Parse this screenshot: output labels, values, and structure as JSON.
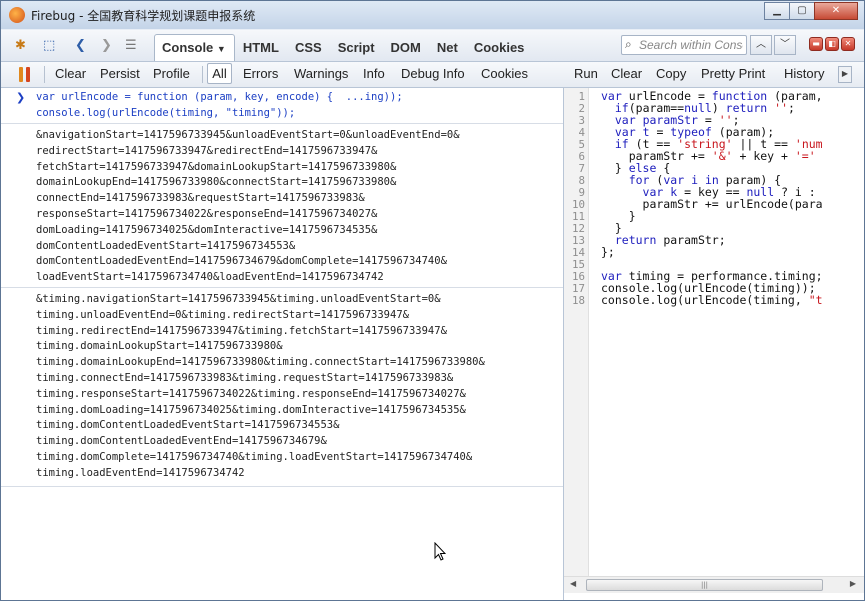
{
  "window": {
    "title": "Firebug - 全国教育科学规划课题申报系统"
  },
  "toolbar_main": {
    "tabs": [
      {
        "label": "Console",
        "active": true
      },
      {
        "label": "HTML"
      },
      {
        "label": "CSS"
      },
      {
        "label": "Script"
      },
      {
        "label": "DOM"
      },
      {
        "label": "Net"
      },
      {
        "label": "Cookies"
      }
    ],
    "search_placeholder": "Search within Console"
  },
  "toolbar_console": {
    "clear": "Clear",
    "persist": "Persist",
    "profile": "Profile",
    "all": "All",
    "errors": "Errors",
    "warnings": "Warnings",
    "info": "Info",
    "debug_info": "Debug Info",
    "cookies": "Cookies",
    "run": "Run",
    "clear_editor": "Clear",
    "copy": "Copy",
    "pretty_print": "Pretty Print",
    "history": "History"
  },
  "console": {
    "prompt": "❯",
    "command_lines": [
      "var urlEncode = function (param, key, encode) {  ...ing));",
      "console.log(urlEncode(timing, \"timing\"));"
    ],
    "output1": [
      "&navigationStart=1417596733945&unloadEventStart=0&unloadEventEnd=0&",
      "redirectStart=1417596733947&redirectEnd=1417596733947&",
      "fetchStart=1417596733947&domainLookupStart=1417596733980&",
      "domainLookupEnd=1417596733980&connectStart=1417596733980&",
      "connectEnd=1417596733983&requestStart=1417596733983&",
      "responseStart=1417596734022&responseEnd=1417596734027&",
      "domLoading=1417596734025&domInteractive=1417596734535&",
      "domContentLoadedEventStart=1417596734553&",
      "domContentLoadedEventEnd=1417596734679&domComplete=1417596734740&",
      "loadEventStart=1417596734740&loadEventEnd=1417596734742"
    ],
    "output2": [
      "&timing.navigationStart=1417596733945&timing.unloadEventStart=0&",
      "timing.unloadEventEnd=0&timing.redirectStart=1417596733947&",
      "timing.redirectEnd=1417596733947&timing.fetchStart=1417596733947&",
      "timing.domainLookupStart=1417596733980&",
      "timing.domainLookupEnd=1417596733980&timing.connectStart=1417596733980&",
      "timing.connectEnd=1417596733983&timing.requestStart=1417596733983&",
      "timing.responseStart=1417596734022&timing.responseEnd=1417596734027&",
      "timing.domLoading=1417596734025&timing.domInteractive=1417596734535&",
      "timing.domContentLoadedEventStart=1417596734553&",
      "timing.domContentLoadedEventEnd=1417596734679&",
      "timing.domComplete=1417596734740&timing.loadEventStart=1417596734740&",
      "timing.loadEventEnd=1417596734742"
    ]
  },
  "editor": {
    "line_numbers": [
      "1",
      "2",
      "3",
      "4",
      "5",
      "6",
      "7",
      "8",
      "9",
      "10",
      "11",
      "12",
      "13",
      "14",
      "15",
      "16",
      "17",
      "18"
    ],
    "code_lines": [
      [
        {
          "t": "var",
          "k": "kw"
        },
        {
          "t": " urlEncode = "
        },
        {
          "t": "function",
          "k": "kw"
        },
        {
          "t": " (param,"
        }
      ],
      [
        {
          "t": "  "
        },
        {
          "t": "if",
          "k": "kw"
        },
        {
          "t": "(param=="
        },
        {
          "t": "null",
          "k": "kw"
        },
        {
          "t": ") "
        },
        {
          "t": "return",
          "k": "kw"
        },
        {
          "t": " "
        },
        {
          "t": "''",
          "k": "str"
        },
        {
          "t": ";"
        }
      ],
      [
        {
          "t": "  "
        },
        {
          "t": "var",
          "k": "kw"
        },
        {
          "t": " "
        },
        {
          "t": "paramStr",
          "k": "kw"
        },
        {
          "t": " = "
        },
        {
          "t": "''",
          "k": "str"
        },
        {
          "t": ";"
        }
      ],
      [
        {
          "t": "  "
        },
        {
          "t": "var",
          "k": "kw"
        },
        {
          "t": " "
        },
        {
          "t": "t",
          "k": "kw"
        },
        {
          "t": " = "
        },
        {
          "t": "typeof",
          "k": "kw"
        },
        {
          "t": " (param);"
        }
      ],
      [
        {
          "t": "  "
        },
        {
          "t": "if",
          "k": "kw"
        },
        {
          "t": " (t == "
        },
        {
          "t": "'string'",
          "k": "str"
        },
        {
          "t": " || t == "
        },
        {
          "t": "'num",
          "k": "str"
        }
      ],
      [
        {
          "t": "    paramStr += "
        },
        {
          "t": "'&'",
          "k": "str"
        },
        {
          "t": " + key + "
        },
        {
          "t": "'='",
          "k": "str"
        }
      ],
      [
        {
          "t": "  } "
        },
        {
          "t": "else",
          "k": "kw"
        },
        {
          "t": " {"
        }
      ],
      [
        {
          "t": "    "
        },
        {
          "t": "for",
          "k": "kw"
        },
        {
          "t": " ("
        },
        {
          "t": "var",
          "k": "kw"
        },
        {
          "t": " "
        },
        {
          "t": "i",
          "k": "kw"
        },
        {
          "t": " "
        },
        {
          "t": "in",
          "k": "kw"
        },
        {
          "t": " param) {"
        }
      ],
      [
        {
          "t": "      "
        },
        {
          "t": "var",
          "k": "kw"
        },
        {
          "t": " "
        },
        {
          "t": "k",
          "k": "kw"
        },
        {
          "t": " = key == "
        },
        {
          "t": "null",
          "k": "kw"
        },
        {
          "t": " ? i :"
        }
      ],
      [
        {
          "t": "      paramStr += urlEncode(para"
        }
      ],
      [
        {
          "t": "    }"
        }
      ],
      [
        {
          "t": "  }"
        }
      ],
      [
        {
          "t": "  "
        },
        {
          "t": "return",
          "k": "kw"
        },
        {
          "t": " paramStr;"
        }
      ],
      [
        {
          "t": "};"
        }
      ],
      [
        {
          "t": ""
        }
      ],
      [
        {
          "t": "var",
          "k": "kw"
        },
        {
          "t": " timing = performance.timing;"
        }
      ],
      [
        {
          "t": "console.log(urlEncode(timing));"
        }
      ],
      [
        {
          "t": "console.log(urlEncode(timing, "
        },
        {
          "t": "\"t",
          "k": "str"
        }
      ]
    ]
  },
  "colors": {
    "keyword": "#1d1dbd",
    "string": "#c8161d",
    "command": "#1c3fc4"
  }
}
